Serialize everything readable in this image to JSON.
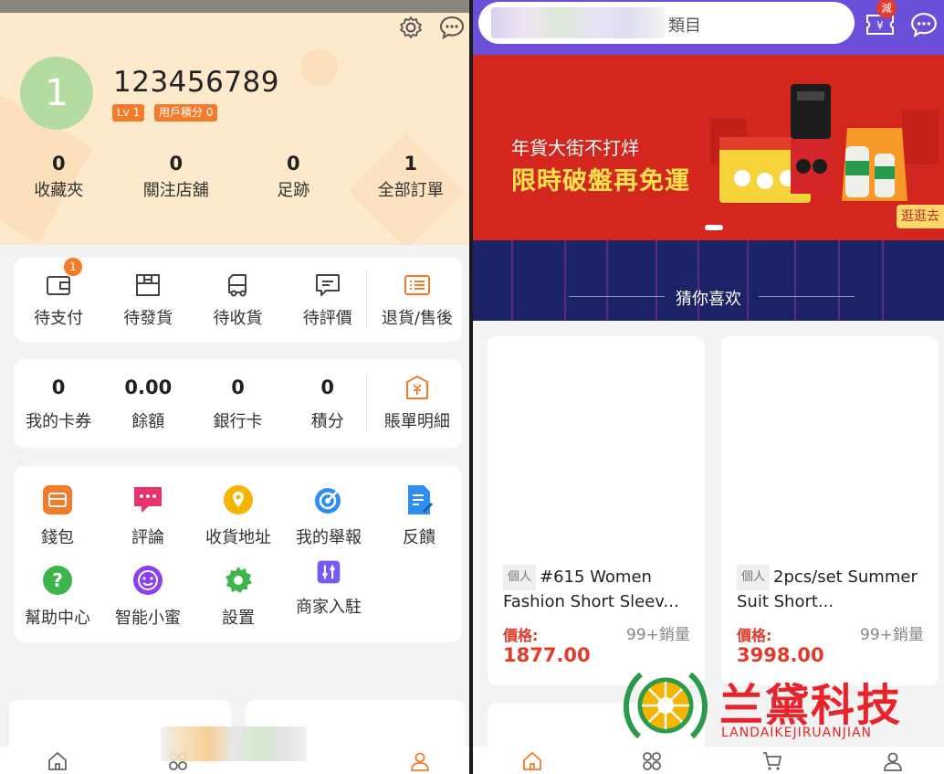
{
  "left": {
    "username": "123456789",
    "avatar_text": "1",
    "badges": [
      "Lv 1",
      "用戶積分 0"
    ],
    "stats": [
      {
        "value": "0",
        "label": "收藏夾"
      },
      {
        "value": "0",
        "label": "關注店舖"
      },
      {
        "value": "0",
        "label": "足跡"
      },
      {
        "value": "1",
        "label": "全部訂單"
      }
    ],
    "orders": [
      {
        "label": "待支付",
        "icon": "wallet-icon",
        "badge": "1"
      },
      {
        "label": "待發貨",
        "icon": "box-icon"
      },
      {
        "label": "待收貨",
        "icon": "truck-icon"
      },
      {
        "label": "待評價",
        "icon": "comment-icon"
      },
      {
        "label": "退貨/售後",
        "icon": "return-icon"
      }
    ],
    "wallet": [
      {
        "value": "0",
        "label": "我的卡券"
      },
      {
        "value": "0.00",
        "label": "餘額"
      },
      {
        "value": "0",
        "label": "銀行卡"
      },
      {
        "value": "0",
        "label": "積分"
      },
      {
        "label": "賬單明細",
        "icon": "bill-icon"
      }
    ],
    "services": [
      {
        "label": "錢包",
        "icon": "wallet-icon",
        "color": "#f47b2a"
      },
      {
        "label": "評論",
        "icon": "chat-icon",
        "color": "#e8336d"
      },
      {
        "label": "收貨地址",
        "icon": "location-icon",
        "color": "#f5b400"
      },
      {
        "label": "我的舉報",
        "icon": "target-icon",
        "color": "#2f8ef0"
      },
      {
        "label": "反饋",
        "icon": "edit-doc-icon",
        "color": "#2f8ef0"
      },
      {
        "label": "幫助中心",
        "icon": "help-icon",
        "color": "#3cb54a"
      },
      {
        "label": "智能小蜜",
        "icon": "smile-icon",
        "color": "#8a3ff0"
      },
      {
        "label": "設置",
        "icon": "gear-icon",
        "color": "#3cb54a"
      },
      {
        "label": "商家入駐",
        "icon": "sliders-icon",
        "color": "#7a5af0"
      }
    ]
  },
  "right": {
    "search_placeholder": "類目",
    "coupon_badge": "減",
    "banner": {
      "line1": "年貨大街不打烊",
      "line2": "限時破盤再免運",
      "cta": "逛逛去"
    },
    "section_title": "猜你喜欢",
    "products": [
      {
        "tag": "個人",
        "name": "#615 Women Fashion Short Sleev...",
        "price_label": "價格:",
        "price": "1877.00",
        "sold": "99+銷量"
      },
      {
        "tag": "個人",
        "name": "2pcs/set Summer Suit Short...",
        "price_label": "價格:",
        "price": "3998.00",
        "sold": "99+銷量"
      }
    ]
  },
  "watermark": {
    "cn": "兰黛科技",
    "en": "LANDAIKEJIRUANJIAN"
  },
  "colors": {
    "accent": "#f47b2a",
    "hero_bg": "#fde9cc",
    "header_purple": "#6c4fd9",
    "banner_red": "#d2261e",
    "price_red": "#e23b2a",
    "brand_red": "#e8242a"
  }
}
